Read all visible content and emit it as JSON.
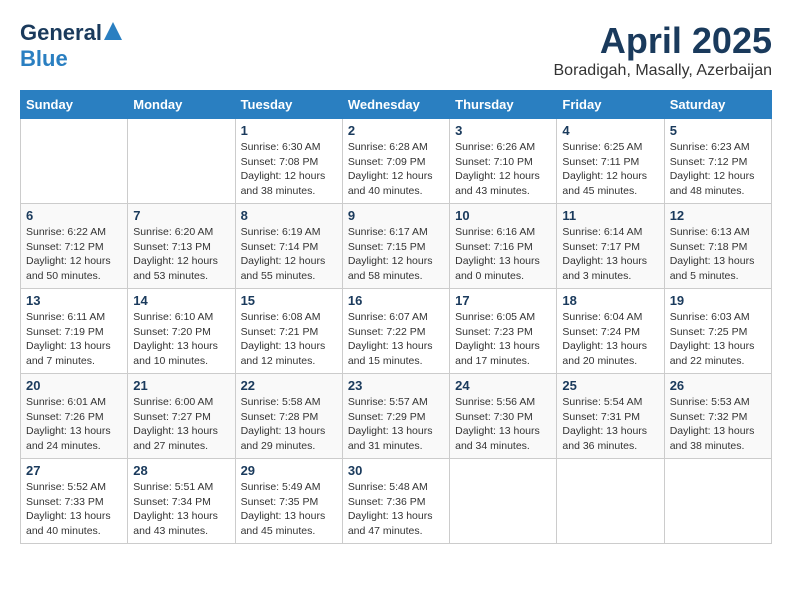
{
  "logo": {
    "general": "General",
    "blue": "Blue"
  },
  "title": "April 2025",
  "location": "Boradigah, Masally, Azerbaijan",
  "weekdays": [
    "Sunday",
    "Monday",
    "Tuesday",
    "Wednesday",
    "Thursday",
    "Friday",
    "Saturday"
  ],
  "weeks": [
    [
      {
        "day": "",
        "info": ""
      },
      {
        "day": "",
        "info": ""
      },
      {
        "day": "1",
        "info": "Sunrise: 6:30 AM\nSunset: 7:08 PM\nDaylight: 12 hours\nand 38 minutes."
      },
      {
        "day": "2",
        "info": "Sunrise: 6:28 AM\nSunset: 7:09 PM\nDaylight: 12 hours\nand 40 minutes."
      },
      {
        "day": "3",
        "info": "Sunrise: 6:26 AM\nSunset: 7:10 PM\nDaylight: 12 hours\nand 43 minutes."
      },
      {
        "day": "4",
        "info": "Sunrise: 6:25 AM\nSunset: 7:11 PM\nDaylight: 12 hours\nand 45 minutes."
      },
      {
        "day": "5",
        "info": "Sunrise: 6:23 AM\nSunset: 7:12 PM\nDaylight: 12 hours\nand 48 minutes."
      }
    ],
    [
      {
        "day": "6",
        "info": "Sunrise: 6:22 AM\nSunset: 7:12 PM\nDaylight: 12 hours\nand 50 minutes."
      },
      {
        "day": "7",
        "info": "Sunrise: 6:20 AM\nSunset: 7:13 PM\nDaylight: 12 hours\nand 53 minutes."
      },
      {
        "day": "8",
        "info": "Sunrise: 6:19 AM\nSunset: 7:14 PM\nDaylight: 12 hours\nand 55 minutes."
      },
      {
        "day": "9",
        "info": "Sunrise: 6:17 AM\nSunset: 7:15 PM\nDaylight: 12 hours\nand 58 minutes."
      },
      {
        "day": "10",
        "info": "Sunrise: 6:16 AM\nSunset: 7:16 PM\nDaylight: 13 hours\nand 0 minutes."
      },
      {
        "day": "11",
        "info": "Sunrise: 6:14 AM\nSunset: 7:17 PM\nDaylight: 13 hours\nand 3 minutes."
      },
      {
        "day": "12",
        "info": "Sunrise: 6:13 AM\nSunset: 7:18 PM\nDaylight: 13 hours\nand 5 minutes."
      }
    ],
    [
      {
        "day": "13",
        "info": "Sunrise: 6:11 AM\nSunset: 7:19 PM\nDaylight: 13 hours\nand 7 minutes."
      },
      {
        "day": "14",
        "info": "Sunrise: 6:10 AM\nSunset: 7:20 PM\nDaylight: 13 hours\nand 10 minutes."
      },
      {
        "day": "15",
        "info": "Sunrise: 6:08 AM\nSunset: 7:21 PM\nDaylight: 13 hours\nand 12 minutes."
      },
      {
        "day": "16",
        "info": "Sunrise: 6:07 AM\nSunset: 7:22 PM\nDaylight: 13 hours\nand 15 minutes."
      },
      {
        "day": "17",
        "info": "Sunrise: 6:05 AM\nSunset: 7:23 PM\nDaylight: 13 hours\nand 17 minutes."
      },
      {
        "day": "18",
        "info": "Sunrise: 6:04 AM\nSunset: 7:24 PM\nDaylight: 13 hours\nand 20 minutes."
      },
      {
        "day": "19",
        "info": "Sunrise: 6:03 AM\nSunset: 7:25 PM\nDaylight: 13 hours\nand 22 minutes."
      }
    ],
    [
      {
        "day": "20",
        "info": "Sunrise: 6:01 AM\nSunset: 7:26 PM\nDaylight: 13 hours\nand 24 minutes."
      },
      {
        "day": "21",
        "info": "Sunrise: 6:00 AM\nSunset: 7:27 PM\nDaylight: 13 hours\nand 27 minutes."
      },
      {
        "day": "22",
        "info": "Sunrise: 5:58 AM\nSunset: 7:28 PM\nDaylight: 13 hours\nand 29 minutes."
      },
      {
        "day": "23",
        "info": "Sunrise: 5:57 AM\nSunset: 7:29 PM\nDaylight: 13 hours\nand 31 minutes."
      },
      {
        "day": "24",
        "info": "Sunrise: 5:56 AM\nSunset: 7:30 PM\nDaylight: 13 hours\nand 34 minutes."
      },
      {
        "day": "25",
        "info": "Sunrise: 5:54 AM\nSunset: 7:31 PM\nDaylight: 13 hours\nand 36 minutes."
      },
      {
        "day": "26",
        "info": "Sunrise: 5:53 AM\nSunset: 7:32 PM\nDaylight: 13 hours\nand 38 minutes."
      }
    ],
    [
      {
        "day": "27",
        "info": "Sunrise: 5:52 AM\nSunset: 7:33 PM\nDaylight: 13 hours\nand 40 minutes."
      },
      {
        "day": "28",
        "info": "Sunrise: 5:51 AM\nSunset: 7:34 PM\nDaylight: 13 hours\nand 43 minutes."
      },
      {
        "day": "29",
        "info": "Sunrise: 5:49 AM\nSunset: 7:35 PM\nDaylight: 13 hours\nand 45 minutes."
      },
      {
        "day": "30",
        "info": "Sunrise: 5:48 AM\nSunset: 7:36 PM\nDaylight: 13 hours\nand 47 minutes."
      },
      {
        "day": "",
        "info": ""
      },
      {
        "day": "",
        "info": ""
      },
      {
        "day": "",
        "info": ""
      }
    ]
  ]
}
